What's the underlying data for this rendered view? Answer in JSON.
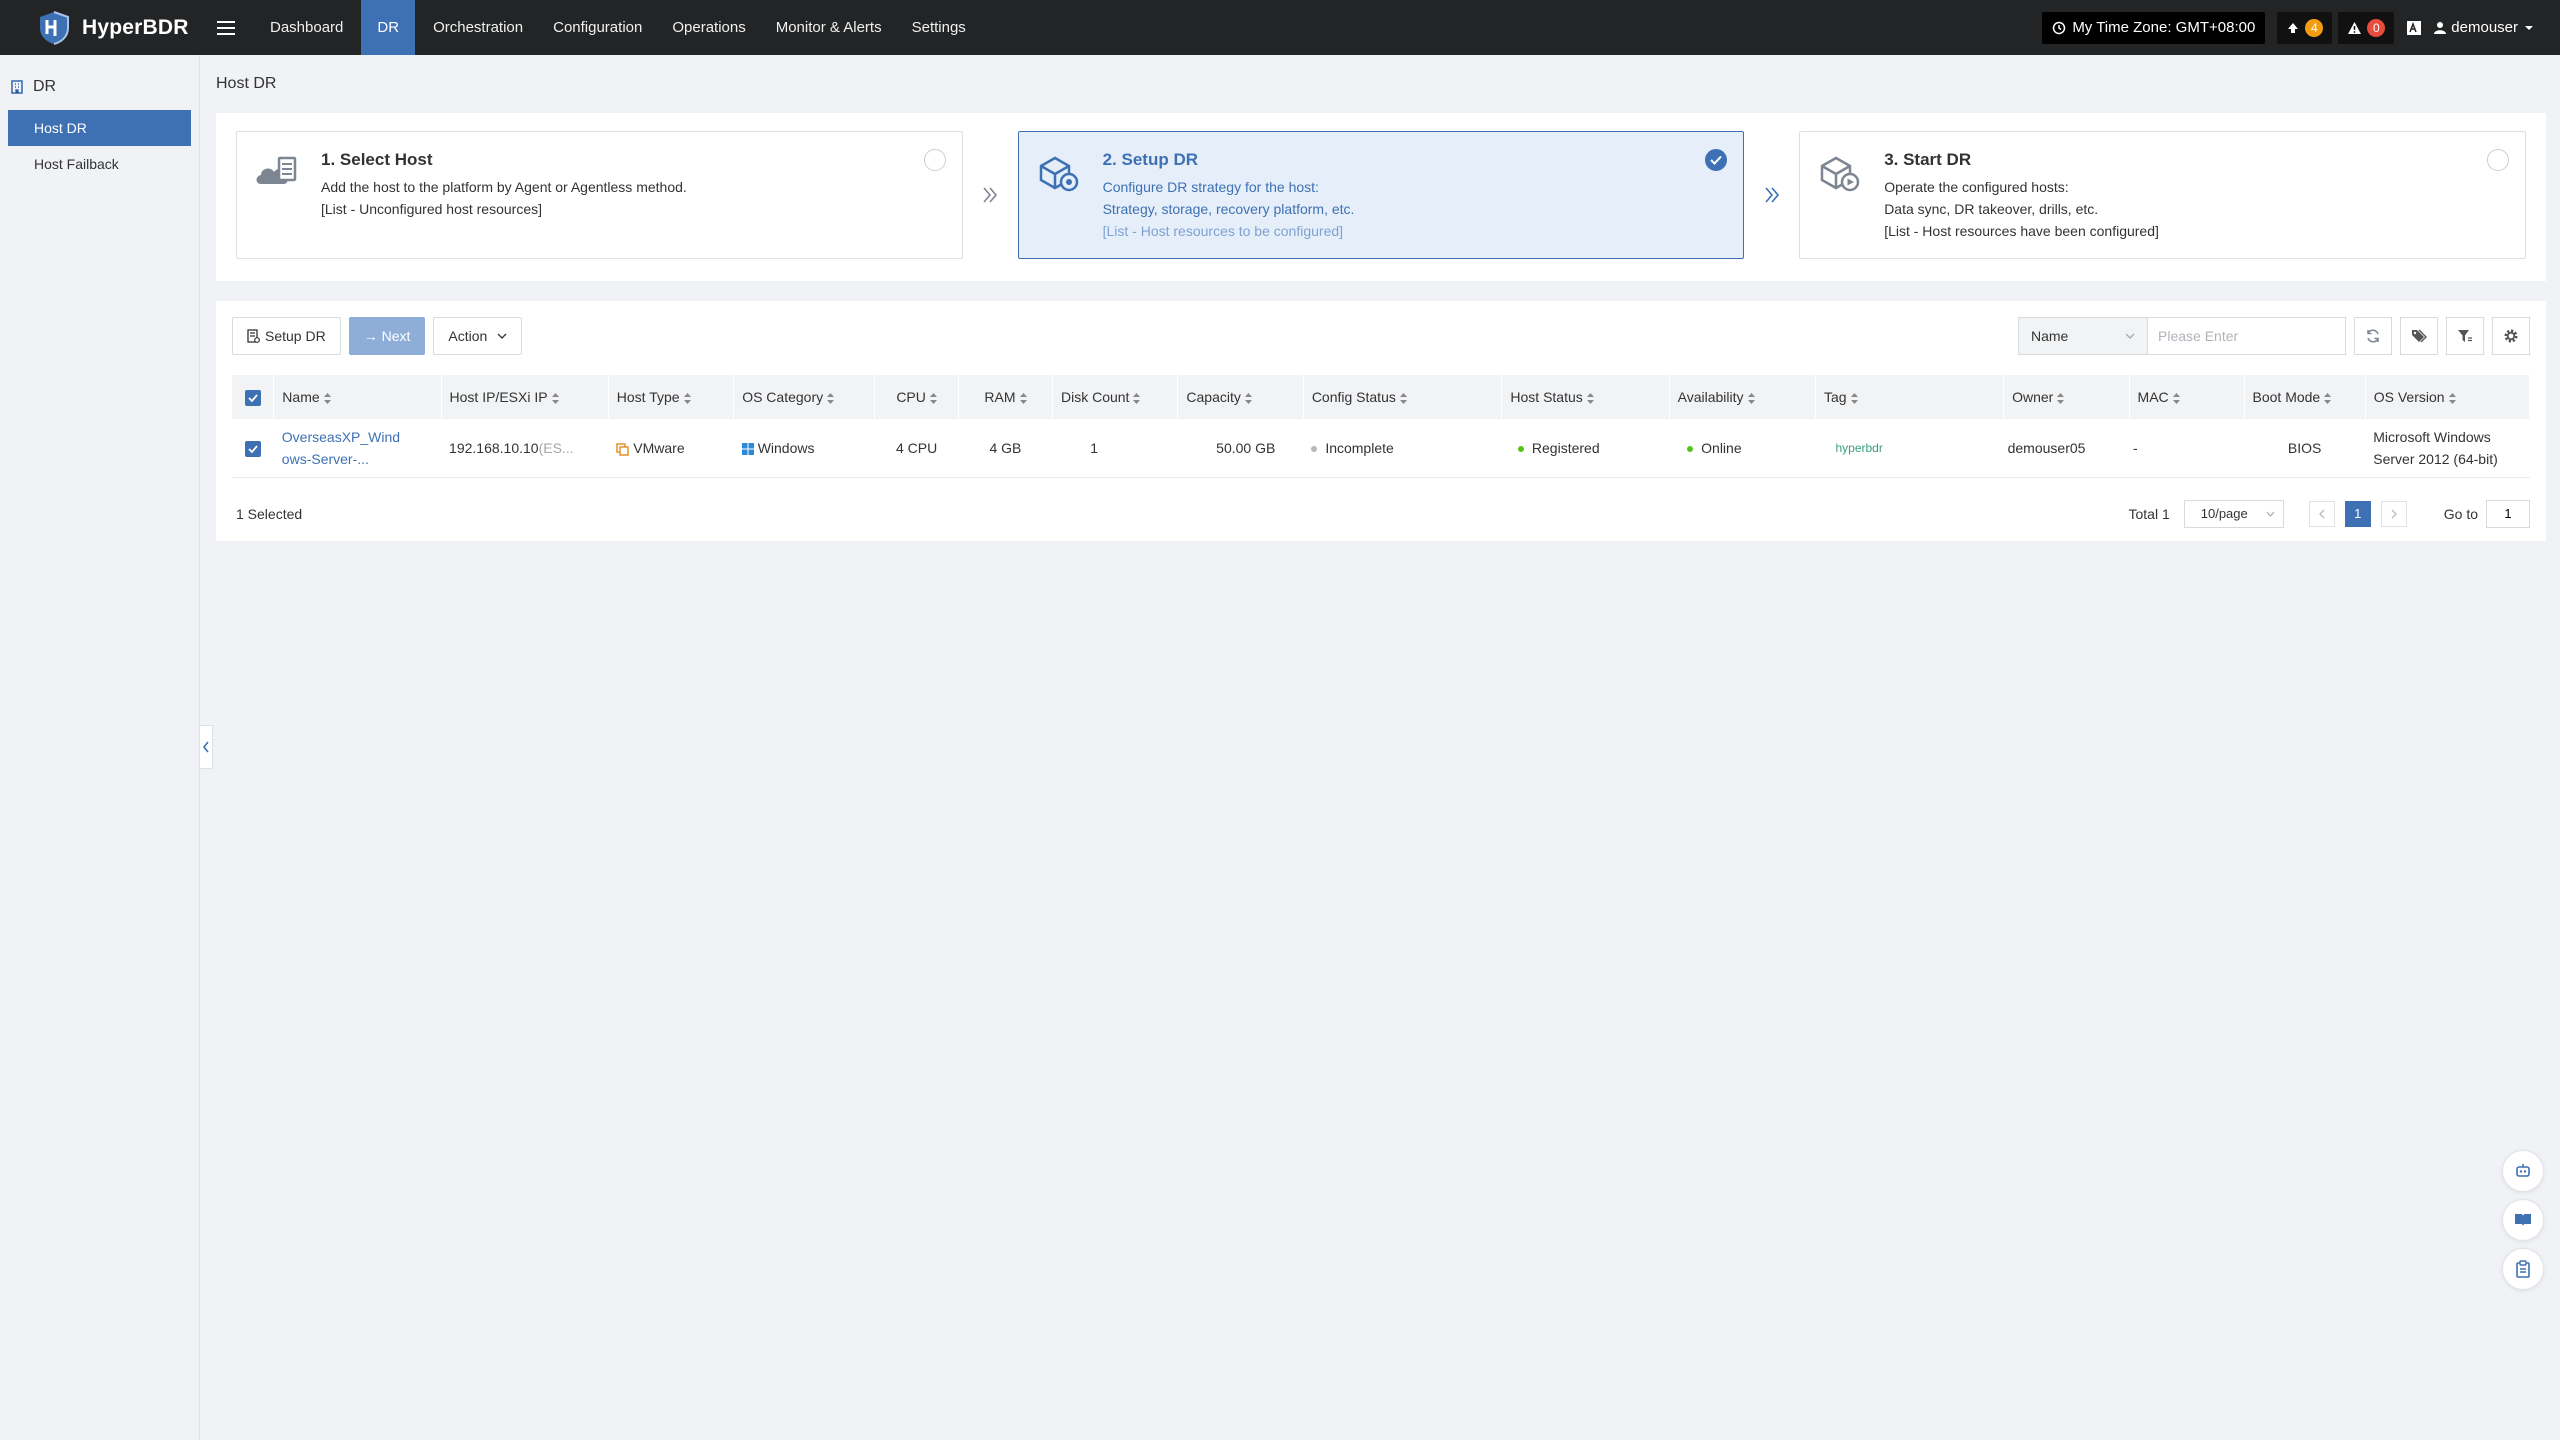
{
  "app": {
    "name": "HyperBDR"
  },
  "nav": [
    {
      "label": "Dashboard",
      "active": false
    },
    {
      "label": "DR",
      "active": true
    },
    {
      "label": "Orchestration",
      "active": false
    },
    {
      "label": "Configuration",
      "active": false
    },
    {
      "label": "Operations",
      "active": false
    },
    {
      "label": "Monitor & Alerts",
      "active": false
    },
    {
      "label": "Settings",
      "active": false
    }
  ],
  "header": {
    "timezone": "My Time Zone: GMT+08:00",
    "upload_count": "4",
    "alert_count": "0",
    "user": "demouser"
  },
  "sidebar": {
    "section": "DR",
    "items": [
      {
        "label": "Host DR",
        "active": true
      },
      {
        "label": "Host Failback",
        "active": false
      }
    ]
  },
  "page": {
    "title": "Host DR"
  },
  "steps": [
    {
      "title": "1. Select Host",
      "lines": [
        "Add the host to the platform by Agent or Agentless method."
      ],
      "note": "[List - Unconfigured host resources]",
      "checked": false
    },
    {
      "title": "2. Setup DR",
      "lines": [
        "Configure DR strategy for the host:",
        "Strategy, storage, recovery platform, etc."
      ],
      "note": "[List - Host resources to be configured]",
      "checked": true
    },
    {
      "title": "3. Start DR",
      "lines": [
        "Operate the configured hosts:",
        "Data sync, DR takeover, drills, etc."
      ],
      "note": "[List - Host resources have been configured]",
      "checked": false
    }
  ],
  "toolbar": {
    "setup_label": "Setup DR",
    "next_label": "→ Next",
    "action_label": "Action",
    "filter_select": "Name",
    "search_placeholder": "Please Enter"
  },
  "table": {
    "columns": [
      "Name",
      "Host IP/ESXi IP",
      "Host Type",
      "OS Category",
      "CPU",
      "RAM",
      "Disk Count",
      "Capacity",
      "Config Status",
      "Host Status",
      "Availability",
      "Tag",
      "Owner",
      "MAC",
      "Boot Mode",
      "OS Version"
    ],
    "rows": [
      {
        "name_line1": "OverseasXP_Wind",
        "name_line2": "ows-Server-...",
        "ip": "192.168.10.10",
        "ip_suffix": "(ES...",
        "host_type": "VMware",
        "os_category": "Windows",
        "cpu": "4 CPU",
        "ram": "4 GB",
        "disk_count": "1",
        "capacity": "50.00 GB",
        "config_status": "Incomplete",
        "host_status": "Registered",
        "availability": "Online",
        "tag": "hyperbdr",
        "owner": "demouser05",
        "mac": "-",
        "boot_mode": "BIOS",
        "os_version_line1": "Microsoft Windows",
        "os_version_line2": "Server 2012 (64-bit)"
      }
    ]
  },
  "footer": {
    "selected": "1 Selected",
    "total": "Total 1",
    "page_size": "10/page",
    "current_page": "1",
    "goto_label": "Go to",
    "goto_value": "1"
  },
  "colors": {
    "accent": "#3e71b4",
    "topbar": "#222426",
    "online": "#52c41a"
  }
}
